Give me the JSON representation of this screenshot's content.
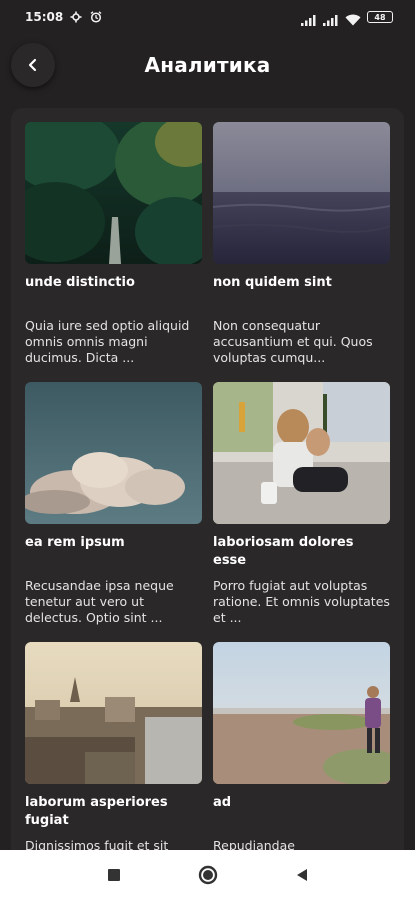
{
  "status_bar": {
    "time": "15:08",
    "battery": "48"
  },
  "app_bar": {
    "title": "Аналитика"
  },
  "cards": [
    {
      "title": "unde distinctio",
      "body": "Quia iure sed optio aliquid omnis omnis magni ducimus. Dicta ..."
    },
    {
      "title": "non quidem sint",
      "body": "Non consequatur accusantium et qui. Quos voluptas cumqu..."
    },
    {
      "title": "ea rem ipsum",
      "body": "Recusandae ipsa neque tenetur aut vero ut delectus. Optio sint ..."
    },
    {
      "title": "laboriosam dolores esse",
      "body": "Porro fugiat aut voluptas ratione. Et omnis voluptates et ..."
    },
    {
      "title": "laborum asperiores fugiat",
      "body": "Dignissimos fugit et sit"
    },
    {
      "title": "ad",
      "body": "Repudiandae"
    }
  ]
}
